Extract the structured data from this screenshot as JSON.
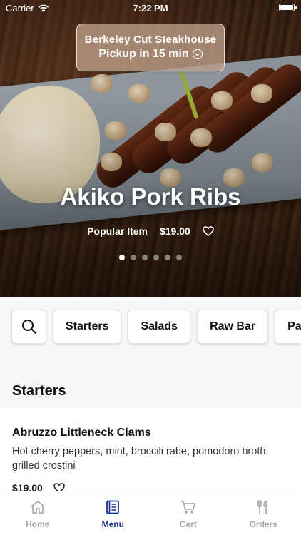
{
  "status_bar": {
    "carrier": "Carrier",
    "time": "7:22 PM"
  },
  "pickup": {
    "restaurant": "Berkeley Cut Steakhouse",
    "time": "Pickup in 15 min"
  },
  "featured": {
    "title": "Akiko Pork Ribs",
    "tag": "Popular Item",
    "price": "$19.00",
    "slide_index": 1,
    "slide_count": 6
  },
  "categories": [
    "Starters",
    "Salads",
    "Raw Bar",
    "Pa"
  ],
  "section": {
    "title": "Starters"
  },
  "items": [
    {
      "name": "Abruzzo Littleneck Clams",
      "description": "Hot cherry peppers, mint, broccili rabe, pomodoro broth, grilled crostini",
      "price": "$19.00"
    }
  ],
  "tabs": [
    {
      "label": "Home",
      "icon": "home-icon",
      "active": false
    },
    {
      "label": "Menu",
      "icon": "menu-book-icon",
      "active": true
    },
    {
      "label": "Cart",
      "icon": "cart-icon",
      "active": false
    },
    {
      "label": "Orders",
      "icon": "utensils-icon",
      "active": false
    }
  ],
  "colors": {
    "accent": "#16308f",
    "inactive_tab": "#a5a5a5"
  }
}
